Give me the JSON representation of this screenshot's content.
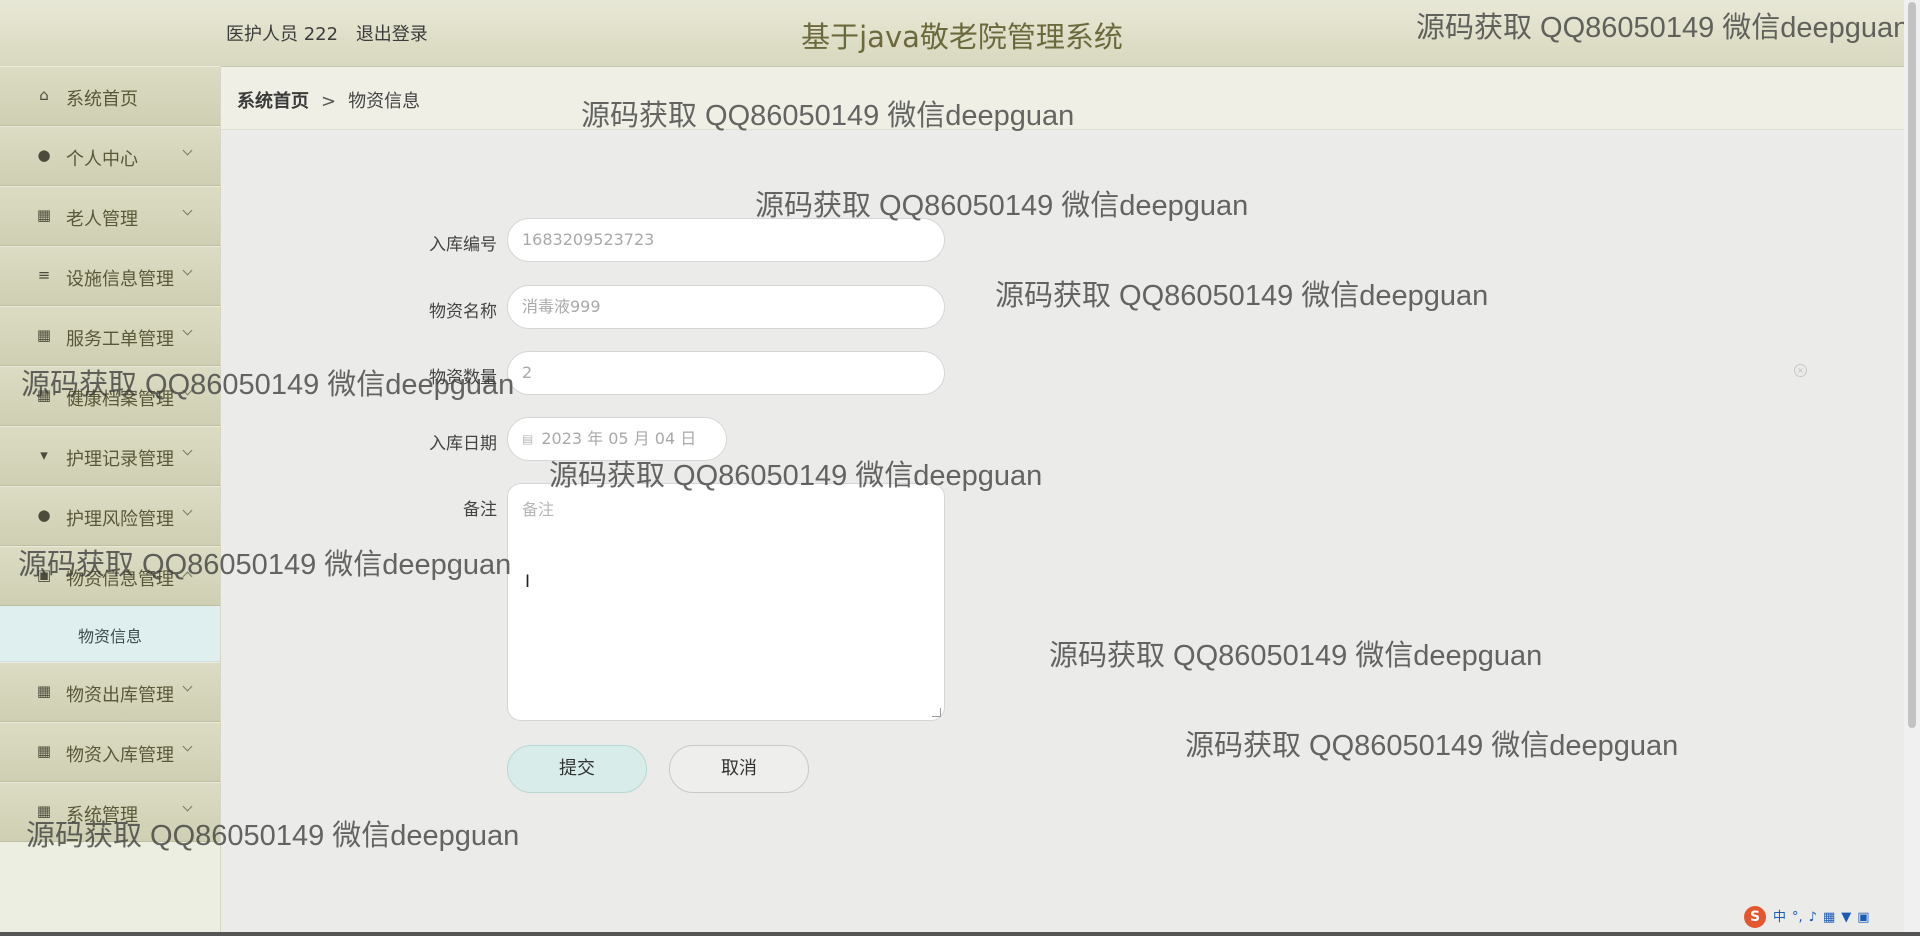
{
  "header": {
    "user": "医护人员 222",
    "logout": "退出登录",
    "title": "基于java敬老院管理系统"
  },
  "sidebar": {
    "items": [
      {
        "label": "系统首页",
        "icon": "home-icon",
        "glyph": "⌂",
        "arrow": false
      },
      {
        "label": "个人中心",
        "icon": "user-icon",
        "glyph": "●",
        "arrow": true
      },
      {
        "label": "老人管理",
        "icon": "grid-icon",
        "glyph": "▦",
        "arrow": true
      },
      {
        "label": "设施信息管理",
        "icon": "list-icon",
        "glyph": "≡",
        "arrow": true
      },
      {
        "label": "服务工单管理",
        "icon": "grid-icon",
        "glyph": "▦",
        "arrow": true
      },
      {
        "label": "健康档案管理",
        "icon": "grid-icon",
        "glyph": "▦",
        "arrow": true
      },
      {
        "label": "护理记录管理",
        "icon": "brush-icon",
        "glyph": "▾",
        "arrow": true
      },
      {
        "label": "护理风险管理",
        "icon": "user-icon",
        "glyph": "●",
        "arrow": true
      },
      {
        "label": "物资信息管理",
        "icon": "clipboard-icon",
        "glyph": "▣",
        "arrow": true,
        "expanded": true
      },
      {
        "label": "物资出库管理",
        "icon": "grid-icon",
        "glyph": "▦",
        "arrow": true
      },
      {
        "label": "物资入库管理",
        "icon": "grid-icon",
        "glyph": "▦",
        "arrow": true
      },
      {
        "label": "系统管理",
        "icon": "grid-icon",
        "glyph": "▦",
        "arrow": true
      }
    ],
    "submenu": "物资信息"
  },
  "breadcrumb": {
    "home": "系统首页",
    "separator": ">",
    "current": "物资信息"
  },
  "form": {
    "fields": [
      {
        "label": "入库编号",
        "value": "1683209523723"
      },
      {
        "label": "物资名称",
        "value": "消毒液999"
      },
      {
        "label": "物资数量",
        "value": "2"
      },
      {
        "label": "入库日期",
        "value": "2023 年 05 月 04 日"
      },
      {
        "label": "备注",
        "placeholder": "备注"
      }
    ],
    "submit": "提交",
    "cancel": "取消"
  },
  "watermark": "源码获取 QQ86050149 微信deepguan",
  "ime": {
    "label": "中"
  },
  "colors": {
    "header_bg": "#dcdcc4",
    "sidebar_item_bg": "#d4d4b9",
    "submenu_bg": "#dfeeee",
    "submit_bg": "#d8ecea",
    "title_color": "#6c6a3c"
  }
}
